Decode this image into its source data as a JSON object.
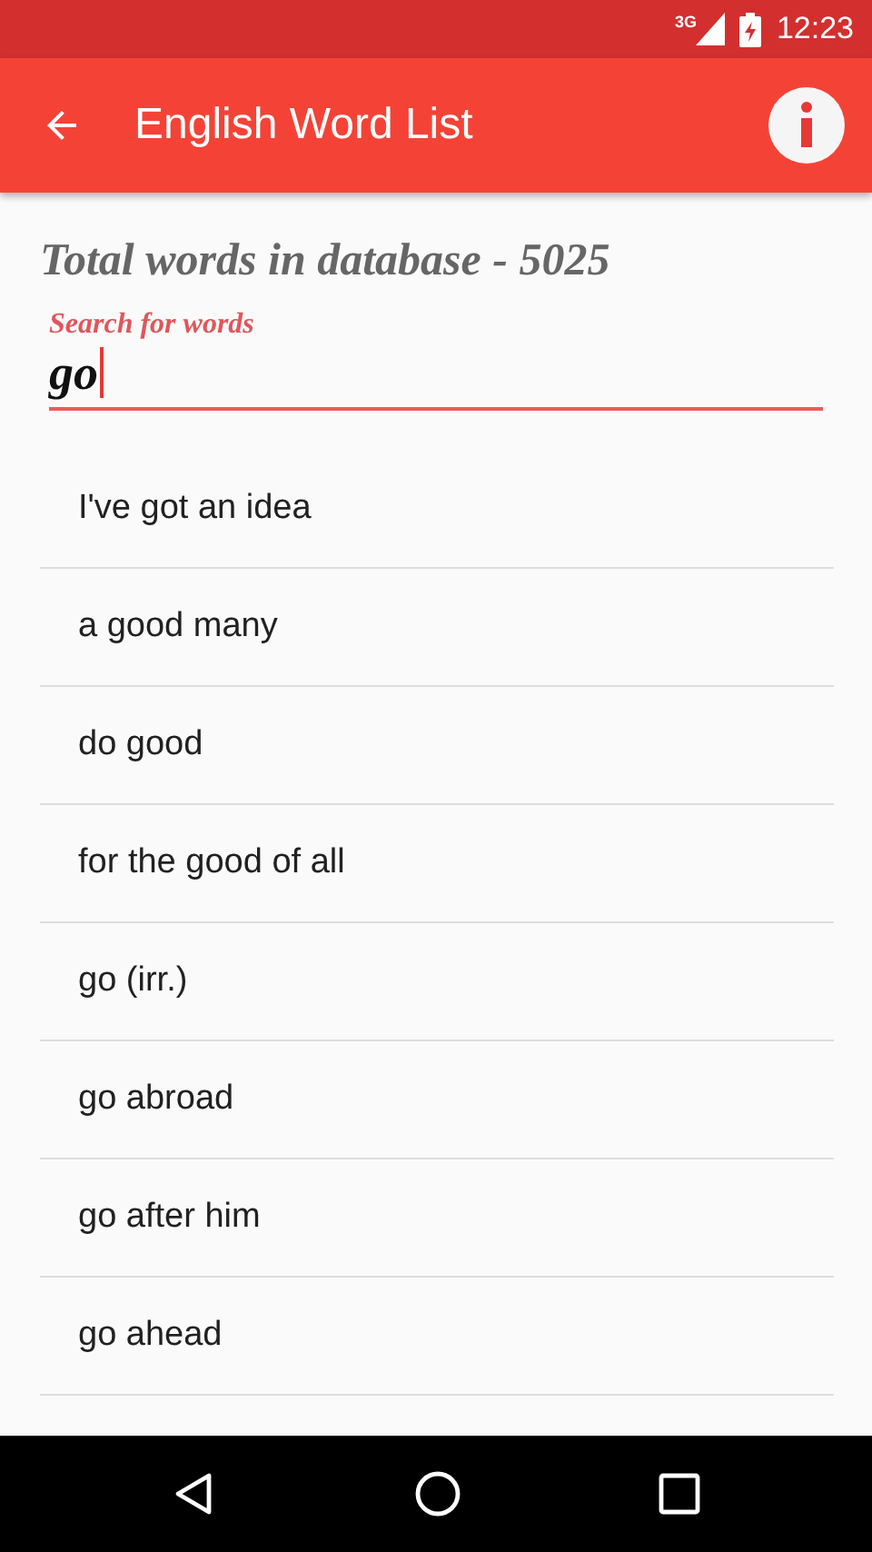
{
  "status_bar": {
    "network": "3G",
    "time": "12:23"
  },
  "app_bar": {
    "title": "English Word List"
  },
  "summary": "Total words in database - 5025",
  "search": {
    "label": "Search for words",
    "value": "go"
  },
  "words": [
    "I've got an idea",
    "a good many",
    "do good",
    "for the good of all",
    "go (irr.)",
    "go abroad",
    "go after him",
    "go ahead"
  ]
}
